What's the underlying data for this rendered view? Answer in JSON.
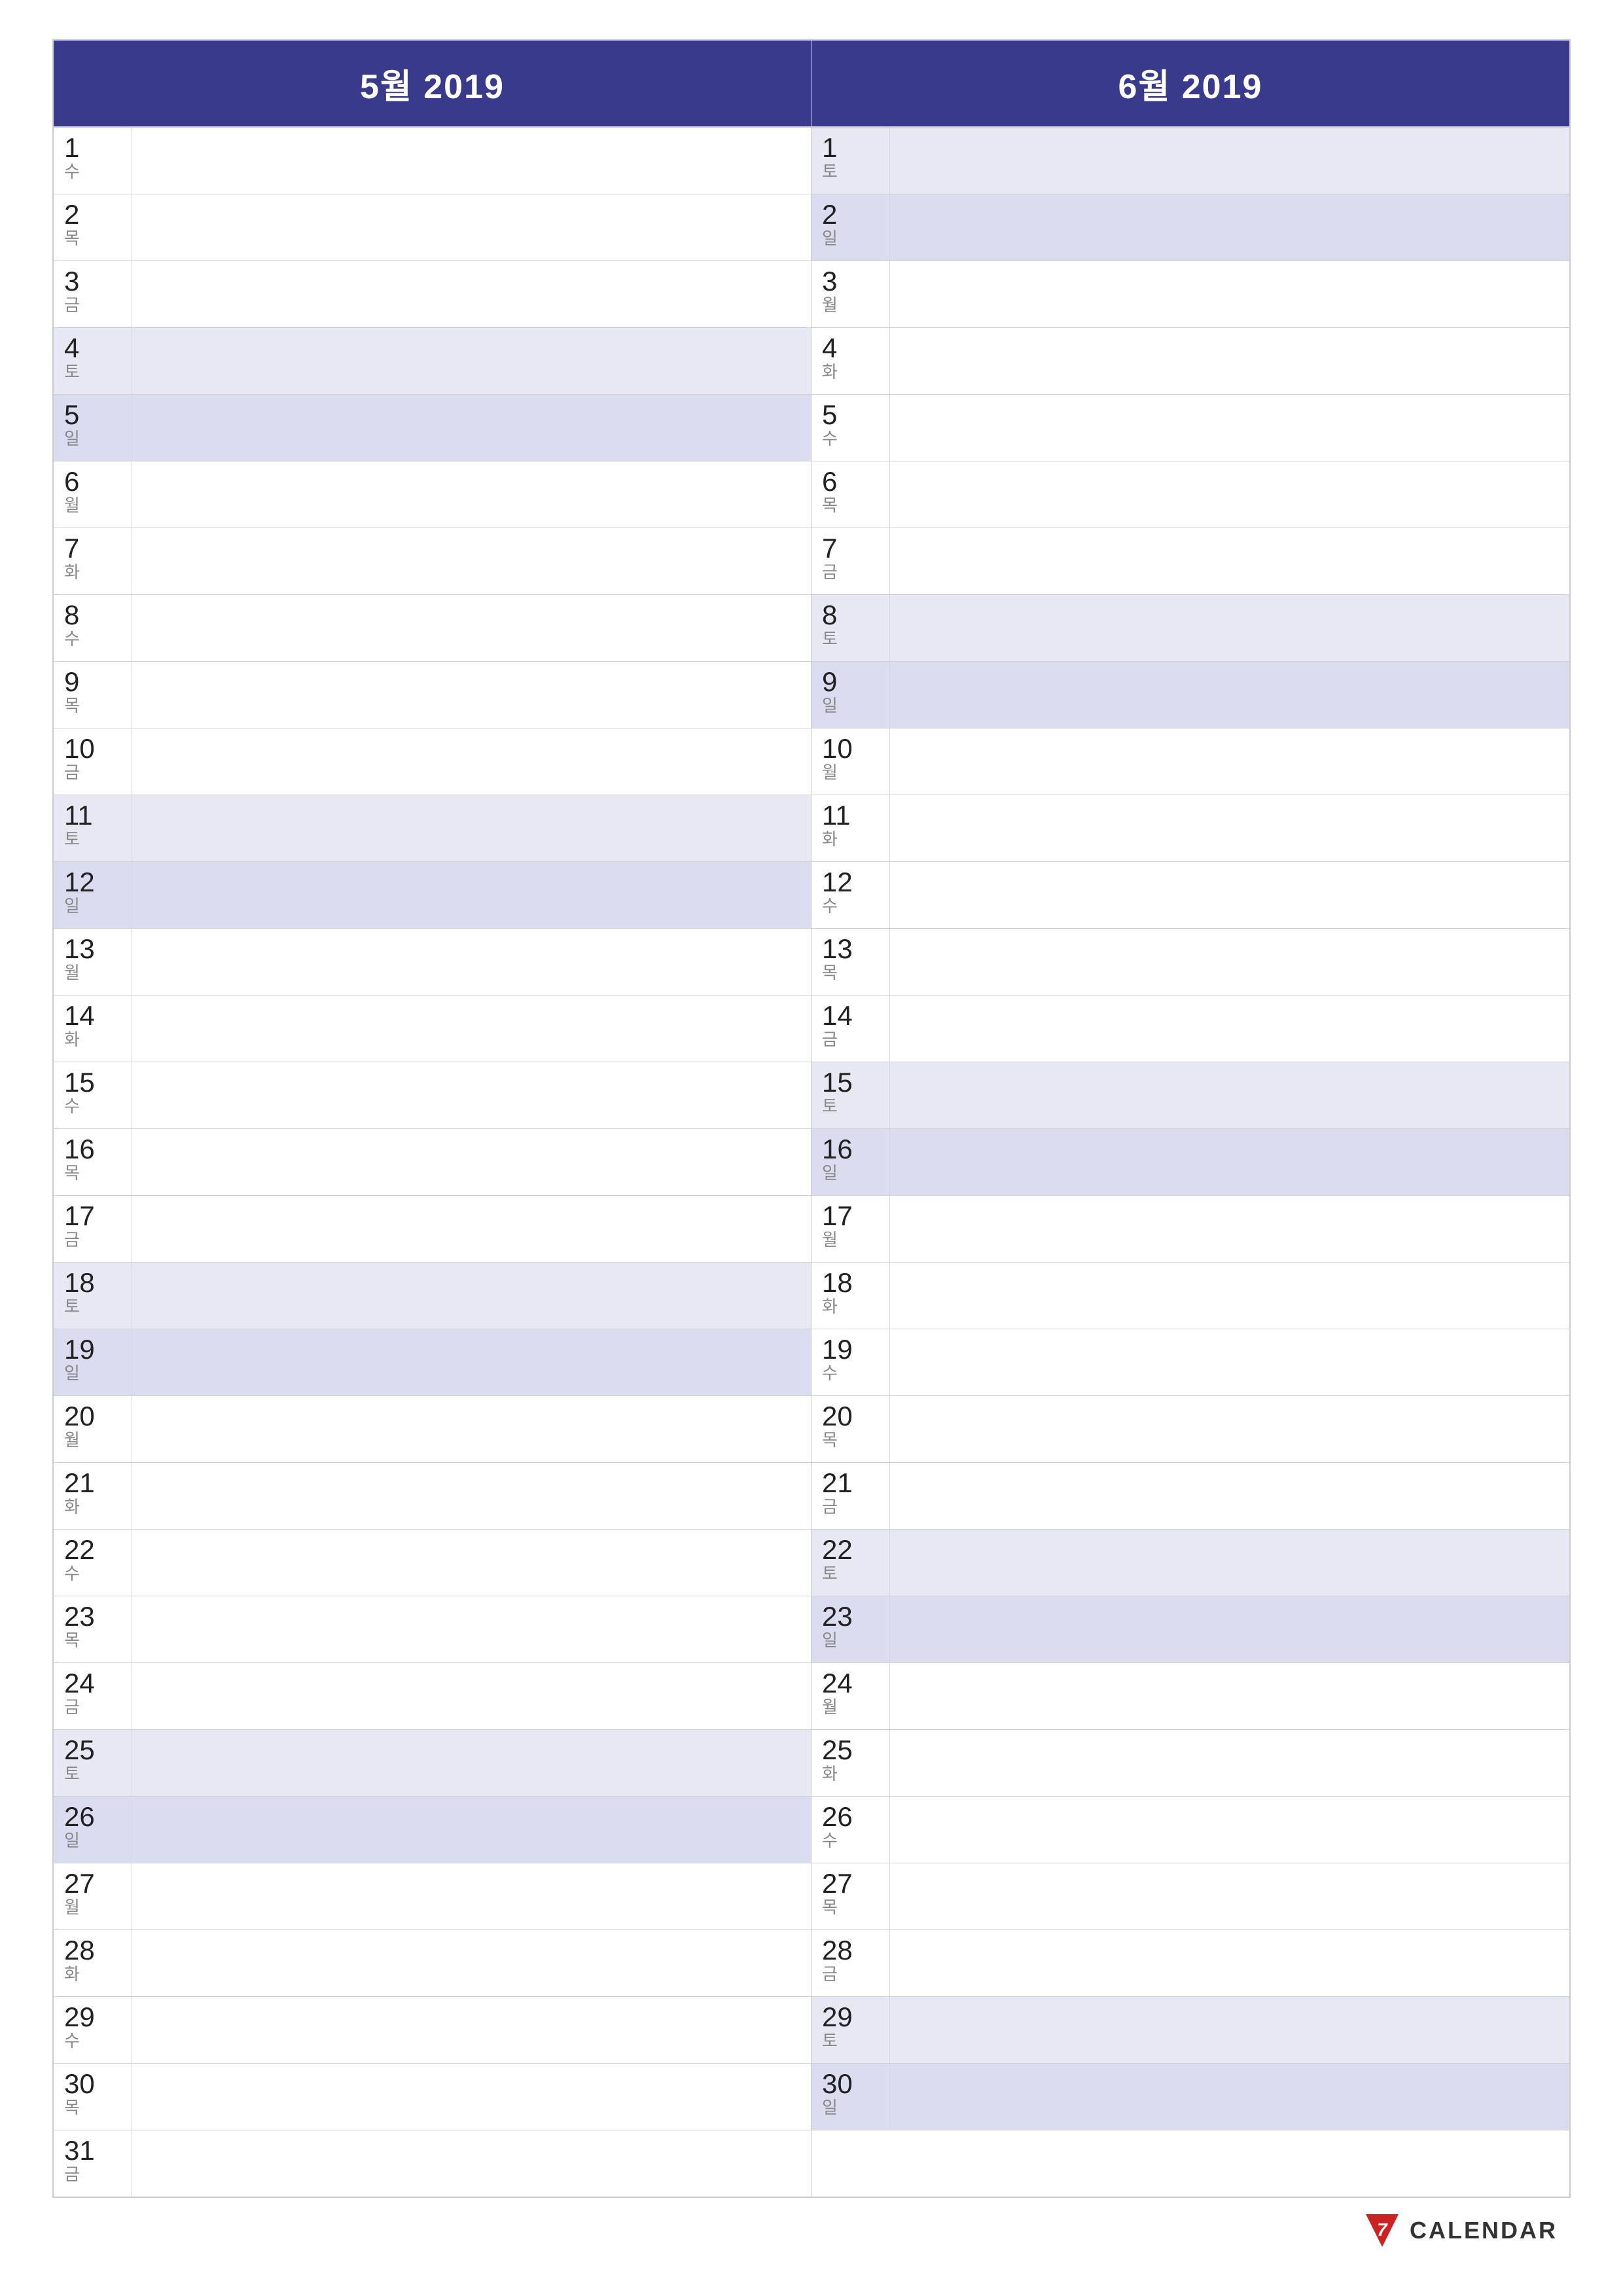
{
  "months": [
    {
      "id": "may",
      "title": "5월 2019",
      "days": [
        {
          "num": "1",
          "name": "수",
          "weekend": false
        },
        {
          "num": "2",
          "name": "목",
          "weekend": false
        },
        {
          "num": "3",
          "name": "금",
          "weekend": false
        },
        {
          "num": "4",
          "name": "토",
          "weekend": "sat"
        },
        {
          "num": "5",
          "name": "일",
          "weekend": "sun"
        },
        {
          "num": "6",
          "name": "월",
          "weekend": false
        },
        {
          "num": "7",
          "name": "화",
          "weekend": false
        },
        {
          "num": "8",
          "name": "수",
          "weekend": false
        },
        {
          "num": "9",
          "name": "목",
          "weekend": false
        },
        {
          "num": "10",
          "name": "금",
          "weekend": false
        },
        {
          "num": "11",
          "name": "토",
          "weekend": "sat"
        },
        {
          "num": "12",
          "name": "일",
          "weekend": "sun"
        },
        {
          "num": "13",
          "name": "월",
          "weekend": false
        },
        {
          "num": "14",
          "name": "화",
          "weekend": false
        },
        {
          "num": "15",
          "name": "수",
          "weekend": false
        },
        {
          "num": "16",
          "name": "목",
          "weekend": false
        },
        {
          "num": "17",
          "name": "금",
          "weekend": false
        },
        {
          "num": "18",
          "name": "토",
          "weekend": "sat"
        },
        {
          "num": "19",
          "name": "일",
          "weekend": "sun"
        },
        {
          "num": "20",
          "name": "월",
          "weekend": false
        },
        {
          "num": "21",
          "name": "화",
          "weekend": false
        },
        {
          "num": "22",
          "name": "수",
          "weekend": false
        },
        {
          "num": "23",
          "name": "목",
          "weekend": false
        },
        {
          "num": "24",
          "name": "금",
          "weekend": false
        },
        {
          "num": "25",
          "name": "토",
          "weekend": "sat"
        },
        {
          "num": "26",
          "name": "일",
          "weekend": "sun"
        },
        {
          "num": "27",
          "name": "월",
          "weekend": false
        },
        {
          "num": "28",
          "name": "화",
          "weekend": false
        },
        {
          "num": "29",
          "name": "수",
          "weekend": false
        },
        {
          "num": "30",
          "name": "목",
          "weekend": false
        },
        {
          "num": "31",
          "name": "금",
          "weekend": false
        }
      ]
    },
    {
      "id": "june",
      "title": "6월 2019",
      "days": [
        {
          "num": "1",
          "name": "토",
          "weekend": "sat"
        },
        {
          "num": "2",
          "name": "일",
          "weekend": "sun"
        },
        {
          "num": "3",
          "name": "월",
          "weekend": false
        },
        {
          "num": "4",
          "name": "화",
          "weekend": false
        },
        {
          "num": "5",
          "name": "수",
          "weekend": false
        },
        {
          "num": "6",
          "name": "목",
          "weekend": false
        },
        {
          "num": "7",
          "name": "금",
          "weekend": false
        },
        {
          "num": "8",
          "name": "토",
          "weekend": "sat"
        },
        {
          "num": "9",
          "name": "일",
          "weekend": "sun"
        },
        {
          "num": "10",
          "name": "월",
          "weekend": false
        },
        {
          "num": "11",
          "name": "화",
          "weekend": false
        },
        {
          "num": "12",
          "name": "수",
          "weekend": false
        },
        {
          "num": "13",
          "name": "목",
          "weekend": false
        },
        {
          "num": "14",
          "name": "금",
          "weekend": false
        },
        {
          "num": "15",
          "name": "토",
          "weekend": "sat"
        },
        {
          "num": "16",
          "name": "일",
          "weekend": "sun"
        },
        {
          "num": "17",
          "name": "월",
          "weekend": false
        },
        {
          "num": "18",
          "name": "화",
          "weekend": false
        },
        {
          "num": "19",
          "name": "수",
          "weekend": false
        },
        {
          "num": "20",
          "name": "목",
          "weekend": false
        },
        {
          "num": "21",
          "name": "금",
          "weekend": false
        },
        {
          "num": "22",
          "name": "토",
          "weekend": "sat"
        },
        {
          "num": "23",
          "name": "일",
          "weekend": "sun"
        },
        {
          "num": "24",
          "name": "월",
          "weekend": false
        },
        {
          "num": "25",
          "name": "화",
          "weekend": false
        },
        {
          "num": "26",
          "name": "수",
          "weekend": false
        },
        {
          "num": "27",
          "name": "목",
          "weekend": false
        },
        {
          "num": "28",
          "name": "금",
          "weekend": false
        },
        {
          "num": "29",
          "name": "토",
          "weekend": "sat"
        },
        {
          "num": "30",
          "name": "일",
          "weekend": "sun"
        }
      ]
    }
  ],
  "footer": {
    "logo_number": "7",
    "logo_text": "CALENDAR"
  }
}
